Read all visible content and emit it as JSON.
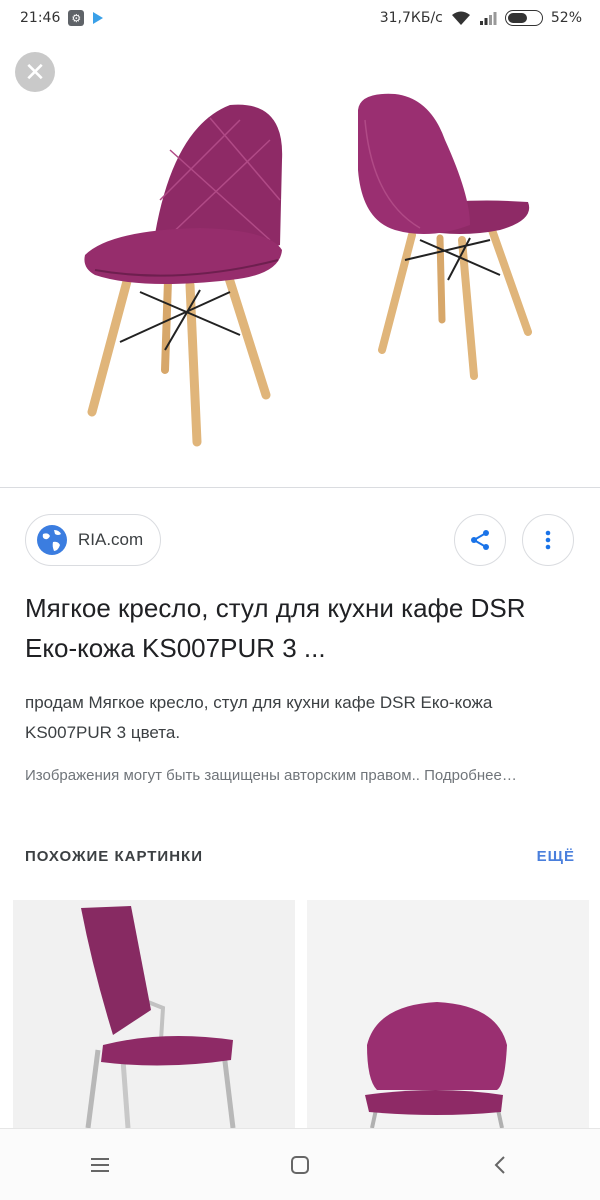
{
  "status_bar": {
    "time": "21:46",
    "network_speed": "31,7КБ/с",
    "battery_percent": "52%",
    "battery_level": 0.52,
    "icons": [
      "settings-notification-icon",
      "play-store-icon",
      "wifi-icon",
      "signal-icon",
      "battery-icon"
    ]
  },
  "viewer": {
    "close_icon": "close-icon"
  },
  "source": {
    "name": "RIA.com",
    "icon": "globe-icon"
  },
  "actions": {
    "share_icon": "share-icon",
    "more_icon": "more-vert-icon"
  },
  "result": {
    "title": "Мягкое кресло, стул для кухни кафе DSR Еко-кожа KS007PUR 3 ...",
    "description": "продам Мягкое кресло, стул для кухни кафе DSR Еко-кожа KS007PUR 3 цвета.",
    "notice": "Изображения могут быть защищены авторским правом.. Подробнее…"
  },
  "related": {
    "header": "ПОХОЖИЕ КАРТИНКИ",
    "more": "ЕЩЁ"
  },
  "colors": {
    "chair_purple": "#8e2a66",
    "wood": "#e0b57a",
    "link_blue": "#4a7fdc"
  },
  "nav_bar": {
    "icons": [
      "menu-icon",
      "home-square-icon",
      "back-icon"
    ]
  }
}
